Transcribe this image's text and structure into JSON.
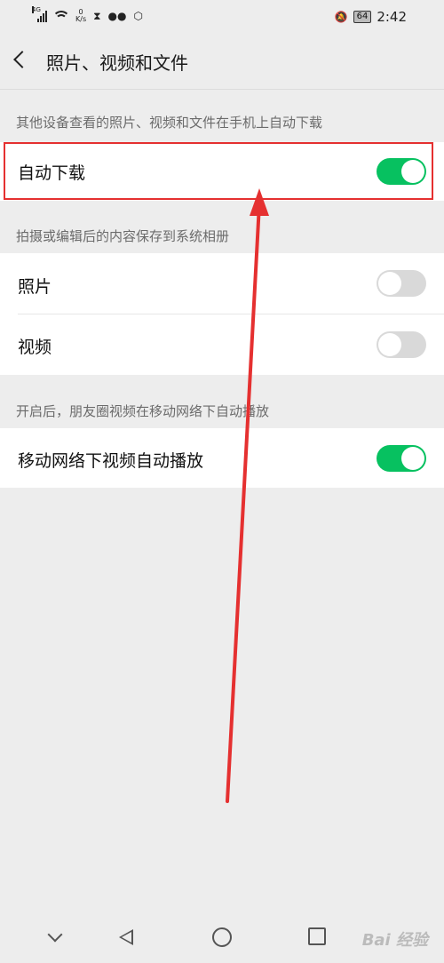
{
  "status_bar": {
    "network_label": "4G",
    "speed_value": "0",
    "speed_unit": "K/s",
    "battery": "64",
    "time": "2:42"
  },
  "header": {
    "title": "照片、视频和文件"
  },
  "sections": [
    {
      "caption": "其他设备查看的照片、视频和文件在手机上自动下载",
      "items": [
        {
          "label": "自动下载",
          "on": true
        }
      ]
    },
    {
      "caption": "拍摄或编辑后的内容保存到系统相册",
      "items": [
        {
          "label": "照片",
          "on": false
        },
        {
          "label": "视频",
          "on": false
        }
      ]
    },
    {
      "caption": "开启后，朋友圈视频在移动网络下自动播放",
      "items": [
        {
          "label": "移动网络下视频自动播放",
          "on": true
        }
      ]
    }
  ],
  "colors": {
    "toggle_on": "#07c160",
    "toggle_off": "#d9d9d9",
    "annotation": "#e53030"
  },
  "watermark": "Bai 经验"
}
